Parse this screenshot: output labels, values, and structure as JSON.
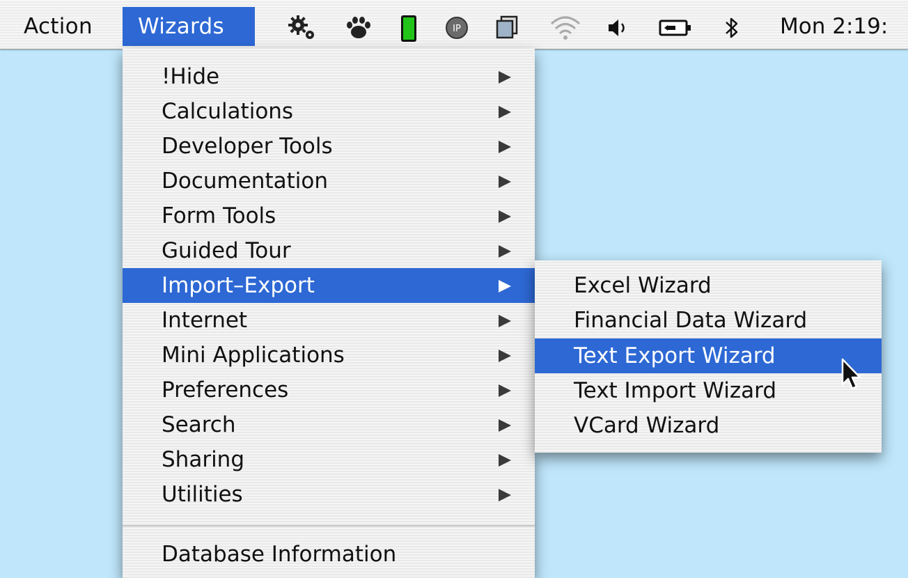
{
  "menubar": {
    "menus": [
      "Action",
      "Wizards"
    ],
    "status_icons": [
      "gears-icon",
      "paw-icon",
      "battery-level-icon",
      "network-globe-icon",
      "display-icon",
      "wifi-icon",
      "volume-icon",
      "power-plug-icon",
      "bluetooth-icon"
    ],
    "clock": "Mon 2:19:"
  },
  "wizards_menu": {
    "items": [
      {
        "label": "!Hide"
      },
      {
        "label": "Calculations"
      },
      {
        "label": "Developer Tools"
      },
      {
        "label": "Documentation"
      },
      {
        "label": "Form Tools"
      },
      {
        "label": "Guided Tour"
      },
      {
        "label": "Import–Export"
      },
      {
        "label": "Internet"
      },
      {
        "label": "Mini Applications"
      },
      {
        "label": "Preferences"
      },
      {
        "label": "Search"
      },
      {
        "label": "Sharing"
      },
      {
        "label": "Utilities"
      }
    ],
    "footer_item": "Database Information",
    "highlighted": "Import–Export"
  },
  "submenu": {
    "items": [
      {
        "label": "Excel Wizard"
      },
      {
        "label": "Financial Data Wizard"
      },
      {
        "label": "Text Export Wizard"
      },
      {
        "label": "Text Import Wizard"
      },
      {
        "label": "VCard Wizard"
      }
    ],
    "highlighted": "Text Export Wizard"
  },
  "colors": {
    "highlight": "#2d68d4",
    "desktop": "#bfe6fb",
    "battery_green": "#22c41a"
  }
}
